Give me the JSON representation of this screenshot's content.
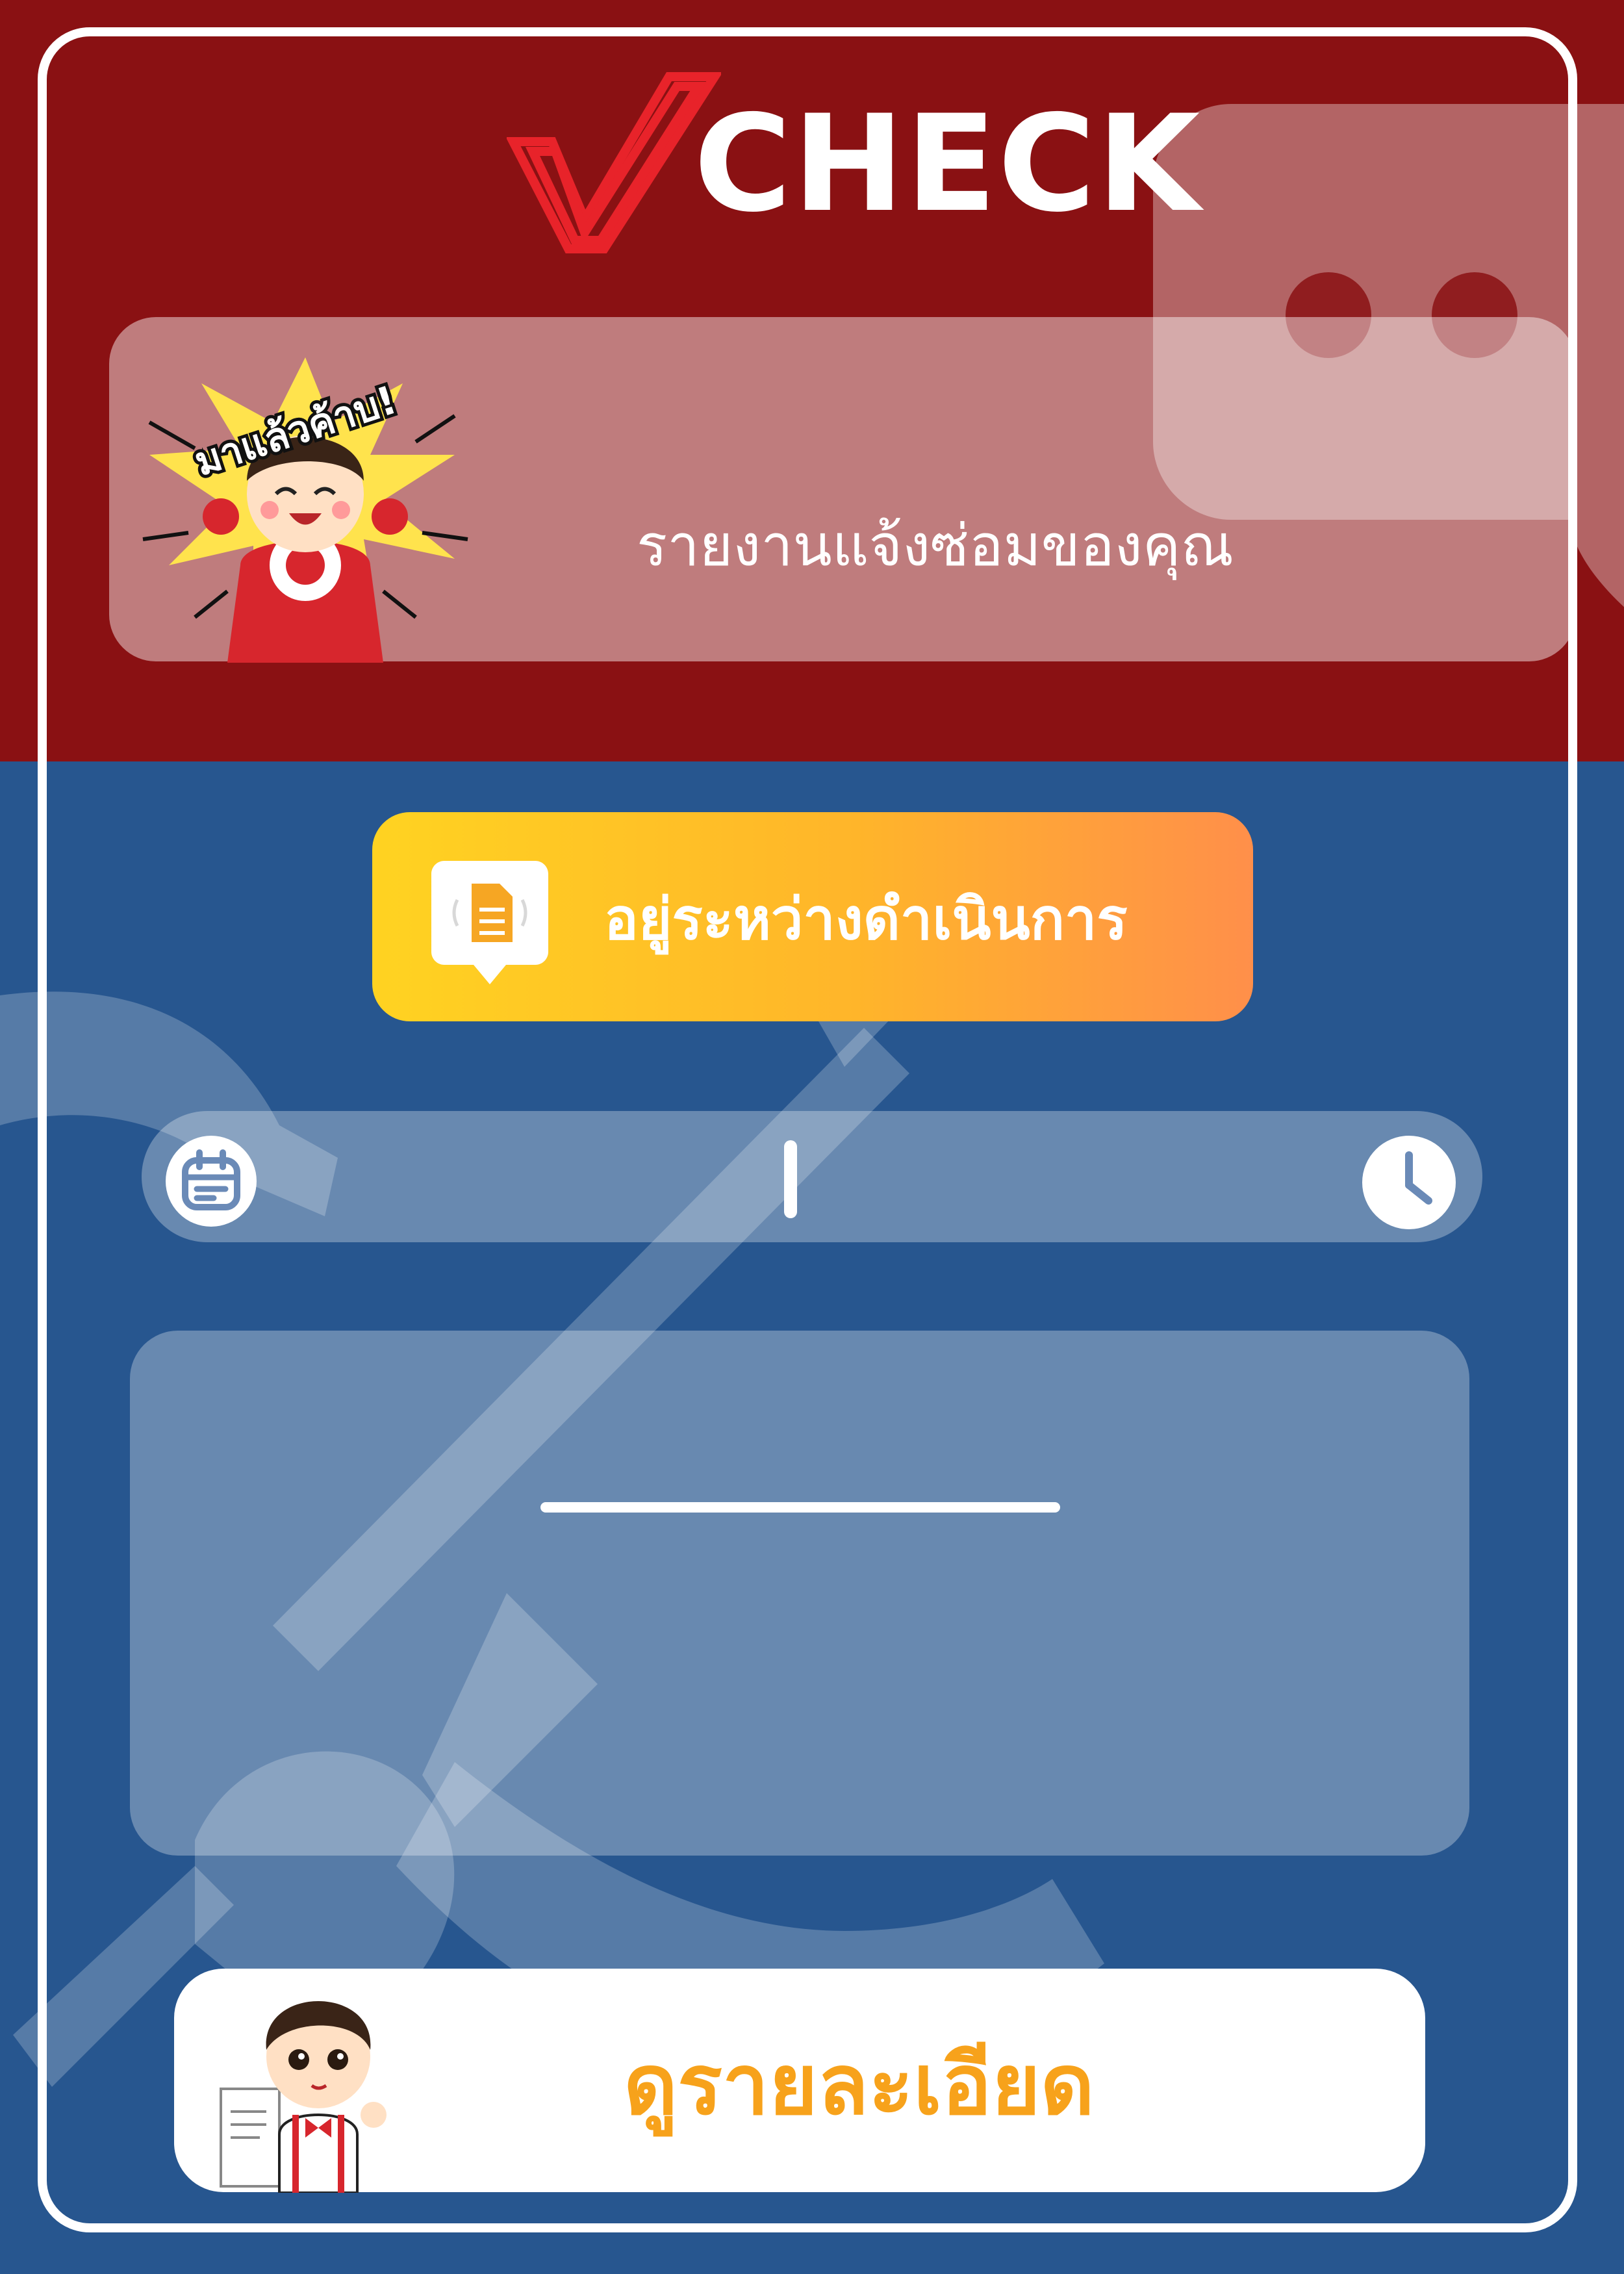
{
  "brand": {
    "logo_text": "CHECK",
    "primary_red": "#8a1113",
    "primary_blue": "#27568f"
  },
  "banner": {
    "mascot_caption": "มาแล้วค้าบ!",
    "title": "รายงานแจ้งซ่อมของคุณ"
  },
  "status": {
    "label": "อยู่ระหว่างดำเนินการ",
    "icon": "document-icon",
    "gradient": [
      "#ffd321",
      "#ff8f4a"
    ]
  },
  "datetime": {
    "date_icon": "calendar-icon",
    "date_value": "",
    "time_icon": "clock-icon",
    "time_value": ""
  },
  "details": {
    "text": ""
  },
  "footer": {
    "button_label": "ดูรายละเอียด",
    "button_color": "#f7a21b"
  }
}
